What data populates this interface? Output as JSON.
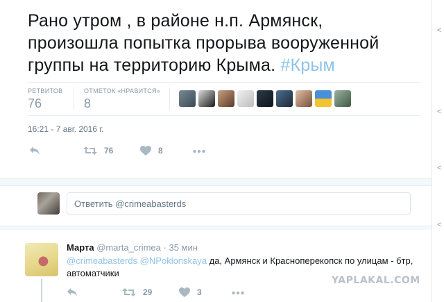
{
  "tweet": {
    "text": "Рано утром , в районе н.п. Армянск, произошла попытка прорыва вооруженной группы на территорию Крыма. ",
    "hashtag": "#Крым",
    "hashtag_color": "#8ec3ea"
  },
  "stats": {
    "retweets_label": "РЕТВИТОВ",
    "retweets_value": "76",
    "likes_label": "ОТМЕТОК «НРАВИТСЯ»",
    "likes_value": "8"
  },
  "liker_avatars": [
    "avatar",
    "avatar",
    "avatar",
    "avatar",
    "avatar",
    "avatar",
    "avatar",
    "avatar",
    "avatar"
  ],
  "timestamp": "16:21 - 7 авг. 2016 г.",
  "actions": {
    "reply_icon": "reply-icon",
    "retweet_icon": "retweet-icon",
    "retweet_count": "76",
    "like_icon": "heart-icon",
    "like_count": "8",
    "more_icon": "more-icon"
  },
  "reply_composer": {
    "placeholder": "Ответить @crimeabasterds"
  },
  "reply": {
    "name": "Марта",
    "handle": "@marta_crimea",
    "dot": "·",
    "time": "35 мин",
    "mention1": "@crimeabasterds",
    "mention2": "@NPoklonskaya",
    "text": " да, Армянск и Красноперекопск по улицам - бтр, автоматчики",
    "retweet_count": "29",
    "like_count": "3"
  },
  "edge_marks": [
    "<",
    "<",
    "<",
    "<"
  ],
  "watermark": "YAPLAKAL.COM"
}
